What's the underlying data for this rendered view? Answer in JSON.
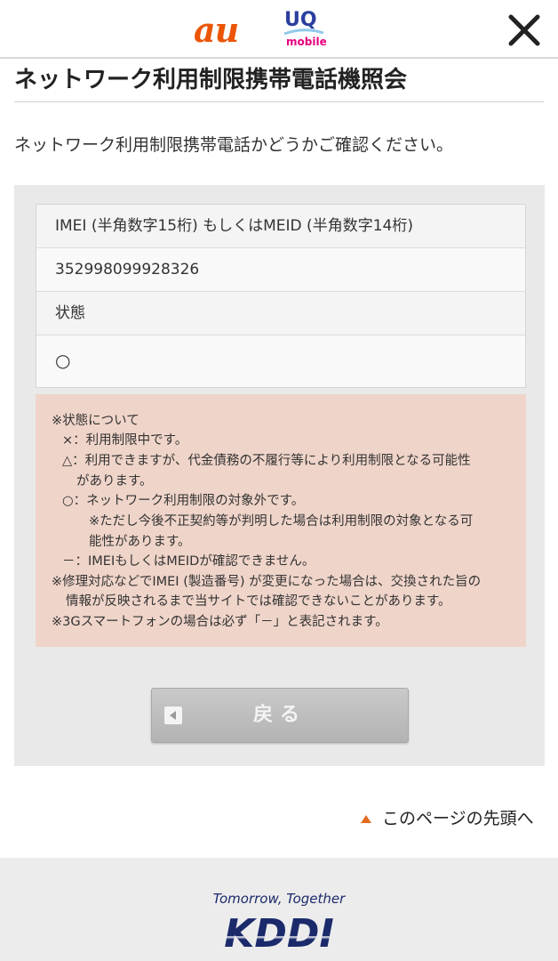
{
  "header": {
    "au_logo": "au",
    "uq_logo": "UQ",
    "uq_mobile": "mobile",
    "close_icon": "close-icon"
  },
  "page": {
    "title": "ネットワーク利用制限携帯電話機照会",
    "intro": "ネットワーク利用制限携帯電話かどうかご確認ください。"
  },
  "result": {
    "imei_label": "IMEI (半角数字15桁) もしくはMEID (半角数字14桁)",
    "imei_value": "352998099928326",
    "status_label": "状態",
    "status_value": "○"
  },
  "notes": {
    "heading": "※状態について",
    "x_line": "×：利用制限中です。",
    "triangle_line1": "△：利用できますが、代金債務の不履行等により利用制限となる可能性",
    "triangle_line2": "があります。",
    "circle_line": "○：ネットワーク利用制限の対象外です。",
    "circle_sub1": "※ただし今後不正契約等が判明した場合は利用制限の対象となる可",
    "circle_sub2": "能性があります。",
    "dash_line": "－：IMEIもしくはMEIDが確認できません。",
    "repair_line1": "※修理対応などでIMEI (製造番号) が変更になった場合は、交換された旨の",
    "repair_line2": "情報が反映されるまで当サイトでは確認できないことがあります。",
    "3g_line": "※3Gスマートフォンの場合は必ず「－」と表記されます。"
  },
  "buttons": {
    "back_label": "戻る"
  },
  "links": {
    "page_top": "このページの先頭へ"
  },
  "footer": {
    "tagline": "Tomorrow, Together",
    "brand": "KDDI"
  },
  "colors": {
    "au_orange": "#eb5505",
    "uq_blue": "#2b3f9e",
    "note_bg": "#efd4c9",
    "kddi_navy": "#1b2a6b"
  }
}
